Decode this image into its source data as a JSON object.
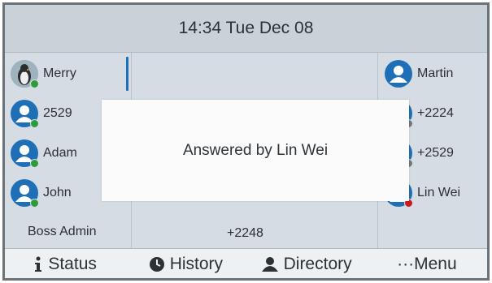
{
  "header": {
    "datetime": "14:34 Tue Dec 08"
  },
  "left_contacts": [
    {
      "name": "Merry",
      "status": "green",
      "avatar": "photo"
    },
    {
      "name": "2529",
      "status": "green",
      "avatar": "default"
    },
    {
      "name": "Adam",
      "status": "green",
      "avatar": "default"
    },
    {
      "name": "John",
      "status": "green",
      "avatar": "default"
    }
  ],
  "left_bottom": "Boss Admin",
  "middle_bottom": "+2248",
  "right_contacts": [
    {
      "name": "Martin",
      "status": "none",
      "avatar": "default"
    },
    {
      "name": "+2224",
      "status": "grey",
      "avatar": "default"
    },
    {
      "name": "+2529",
      "status": "grey",
      "avatar": "default"
    },
    {
      "name": "Lin Wei",
      "status": "red",
      "avatar": "default"
    }
  ],
  "popup": {
    "message": "Answered by Lin Wei"
  },
  "softkeys": [
    {
      "label": "Status",
      "icon": "info-icon"
    },
    {
      "label": "History",
      "icon": "clock-icon"
    },
    {
      "label": "Directory",
      "icon": "contacts-icon"
    },
    {
      "label": "···Menu",
      "icon": ""
    }
  ],
  "colors": {
    "accent": "#1f6fb7",
    "presence_online": "#2e9b3a",
    "presence_busy": "#d01818",
    "presence_offline": "#6f777d"
  }
}
